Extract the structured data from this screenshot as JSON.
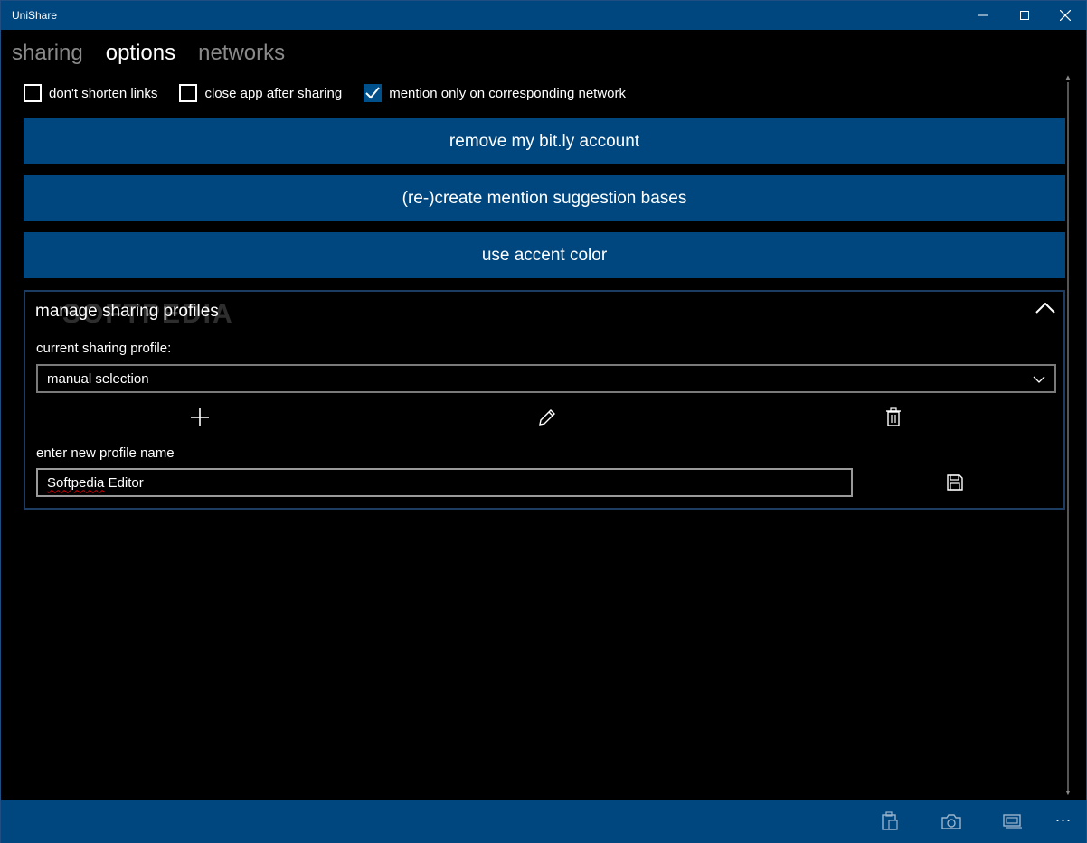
{
  "window": {
    "title": "UniShare",
    "accent_color": "#00477f"
  },
  "pivot": {
    "tabs": [
      {
        "label": "sharing",
        "active": false
      },
      {
        "label": "options",
        "active": true
      },
      {
        "label": "networks",
        "active": false
      }
    ]
  },
  "options": {
    "checkboxes": [
      {
        "label": "don't shorten links",
        "checked": false
      },
      {
        "label": "close app after sharing",
        "checked": false
      },
      {
        "label": "mention only on corresponding network",
        "checked": true
      }
    ],
    "buttons": {
      "remove_bitly": "remove my bit.ly account",
      "recreate_bases": "(re-)create mention suggestion bases",
      "accent_color": "use accent color"
    }
  },
  "profiles": {
    "title": "manage sharing profiles",
    "current_label": "current sharing profile:",
    "current_value": "manual selection",
    "new_name_label": "enter new profile name",
    "new_name_value_word1": "Softpedia",
    "new_name_value_word2": " Editor"
  },
  "watermark": "SOFTPEDIA",
  "icons": {
    "add": "plus-icon",
    "edit": "pencil-icon",
    "delete": "trash-icon",
    "save": "floppy-disk-icon",
    "appbar": [
      "clipboard-icon",
      "camera-icon",
      "screen-capture-icon",
      "more-icon"
    ]
  },
  "appbar": {
    "more_label": "..."
  }
}
